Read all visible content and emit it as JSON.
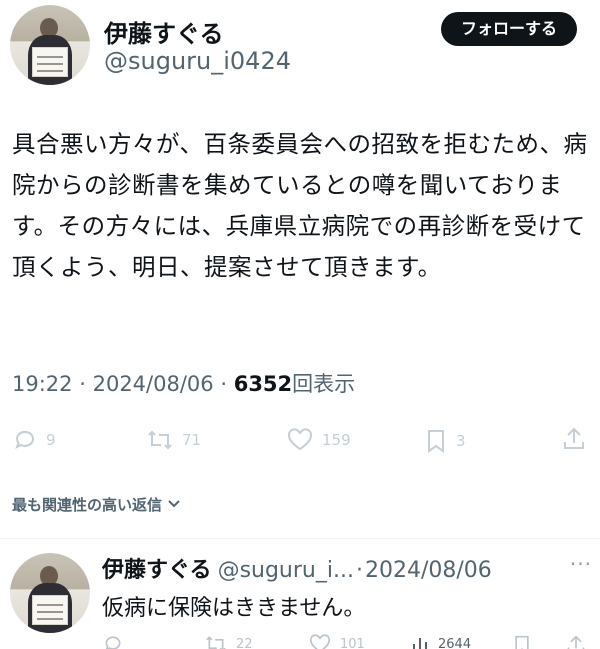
{
  "tweet": {
    "author_name": "伊藤すぐる",
    "author_handle": "@suguru_i0424",
    "follow_label": "フォローする",
    "text": "具合悪い方々が、百条委員会への招致を拒むため、病院からの診断書を集めているとの噂を聞いております。その方々には、兵庫県立病院での再診断を受けて頂くよう、明日、提案させて頂きます。",
    "time": "19:22",
    "date": "2024/08/06",
    "separator": "·",
    "views_count": "6352",
    "views_label": "回表示",
    "actions": {
      "replies": "9",
      "reposts": "71",
      "likes": "159",
      "bookmarks": "3"
    }
  },
  "replies_sort": {
    "label": "最も関連性の高い返信"
  },
  "reply": {
    "author_name": "伊藤すぐる",
    "author_handle": "@suguru_i...",
    "separator": "·",
    "date": "2024/08/06",
    "more": "···",
    "text": "仮病に保険はききません。",
    "actions": {
      "reposts": "22",
      "likes": "101",
      "views": "2644"
    }
  },
  "icons": {
    "reply": "reply-icon",
    "repost": "repost-icon",
    "like": "heart-icon",
    "bookmark": "bookmark-icon",
    "share": "share-icon",
    "views": "views-icon",
    "chevron": "chevron-down-icon",
    "more": "more-icon"
  },
  "colors": {
    "text_primary": "#0f1419",
    "text_secondary": "#536471",
    "action_icon": "#c4cfd6",
    "follow_button_bg": "#0f1419",
    "follow_button_text": "#ffffff"
  }
}
